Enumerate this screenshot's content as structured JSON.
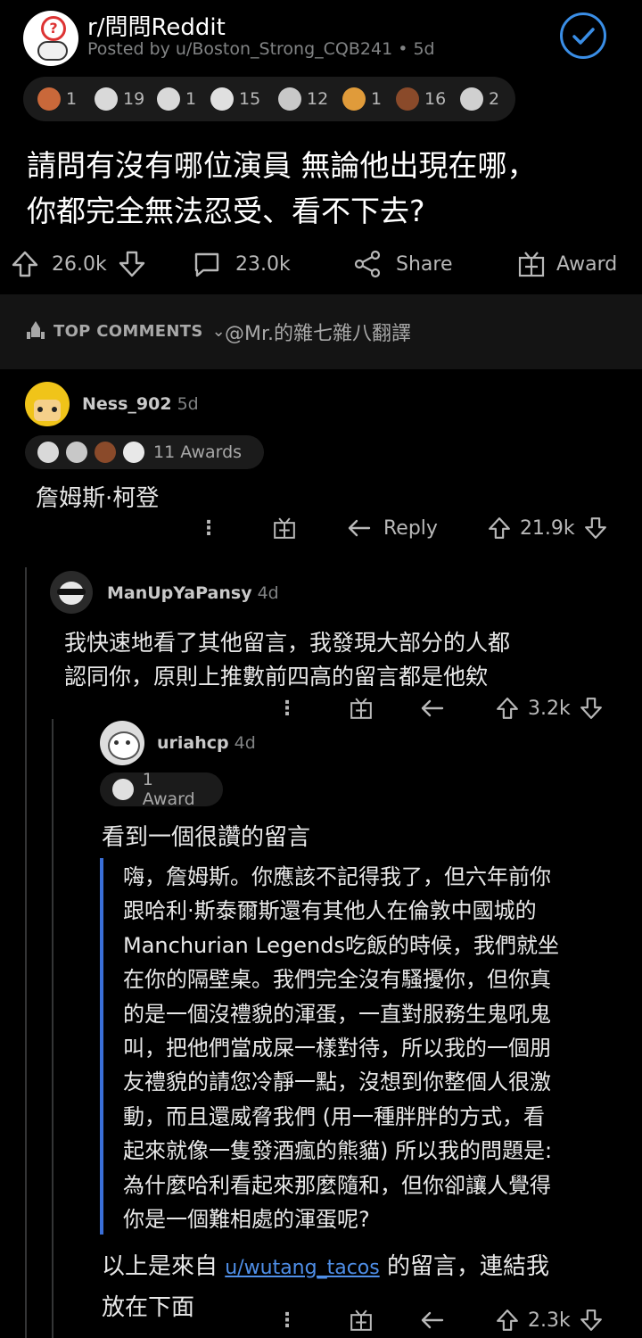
{
  "post": {
    "subreddit": "r/問問Reddit",
    "posted_by": "Posted by u/Boston_Strong_CQB241 • 5d",
    "awards": [
      {
        "icon": "wholesome-award-icon",
        "count": "1",
        "color": "#c9683a"
      },
      {
        "icon": "helpful-award-icon",
        "count": "19",
        "color": "#d9d9d9"
      },
      {
        "icon": "praise-award-icon",
        "count": "1",
        "color": "#d9d9d9"
      },
      {
        "icon": "silver-award-icon",
        "count": "15",
        "color": "#e0e0e0"
      },
      {
        "icon": "silver-coin-award-icon",
        "count": "12",
        "color": "#c8c8c8"
      },
      {
        "icon": "rocket-like-award-icon",
        "count": "1",
        "color": "#e09b3a"
      },
      {
        "icon": "bear-award-icon",
        "count": "16",
        "color": "#8a4a2a"
      },
      {
        "icon": "party-award-icon",
        "count": "2",
        "color": "#d0d0d0"
      }
    ],
    "title_line1": "請問有沒有哪位演員 無論他出現在哪，",
    "title_line2": "你都完全無法忍受、看不下去?",
    "upvotes": "26.0k",
    "comments": "23.0k",
    "share_label": "Share",
    "award_label": "Award"
  },
  "section": {
    "sort_label": "TOP COMMENTS",
    "credit": "@Mr.的雜七雜八翻譯"
  },
  "comment1": {
    "username": "Ness_902",
    "age": "5d",
    "awards_label": "11 Awards",
    "body": "詹姆斯·柯登",
    "reply_label": "Reply",
    "score": "21.9k"
  },
  "comment2": {
    "username": "ManUpYaPansy",
    "age": "4d",
    "body_line1": "我快速地看了其他留言，我發現大部分的人都",
    "body_line2": "認同你，原則上推數前四高的留言都是他欸",
    "score": "3.2k"
  },
  "comment3": {
    "username": "uriahcp",
    "age": "4d",
    "awards_label": "1 Award",
    "intro": "看到一個很讚的留言",
    "quote_lines": [
      "嗨，詹姆斯。你應該不記得我了，但六年前你",
      "跟哈利·斯泰爾斯還有其他人在倫敦中國城的",
      "Manchurian Legends吃飯的時候，我們就坐",
      "在你的隔壁桌。我們完全沒有騷擾你，但你真",
      "的是一個沒禮貌的渾蛋，一直對服務生鬼吼鬼",
      "叫，把他們當成屎一樣對待，所以我的一個朋",
      "友禮貌的請您冷靜一點，沒想到你整個人很激",
      "動，而且還威脅我們 (用一種胖胖的方式，看",
      "起來就像一隻發酒瘋的熊貓) 所以我的問題是:",
      "為什麼哈利看起來那麼隨和，但你卻讓人覺得",
      "你是一個難相處的渾蛋呢?"
    ],
    "footer_prefix": "以上是來自",
    "footer_link": "u/wutang_tacos",
    "footer_suffix": "的留言，連結我",
    "footer_line2": "放在下面",
    "score": "2.3k"
  }
}
